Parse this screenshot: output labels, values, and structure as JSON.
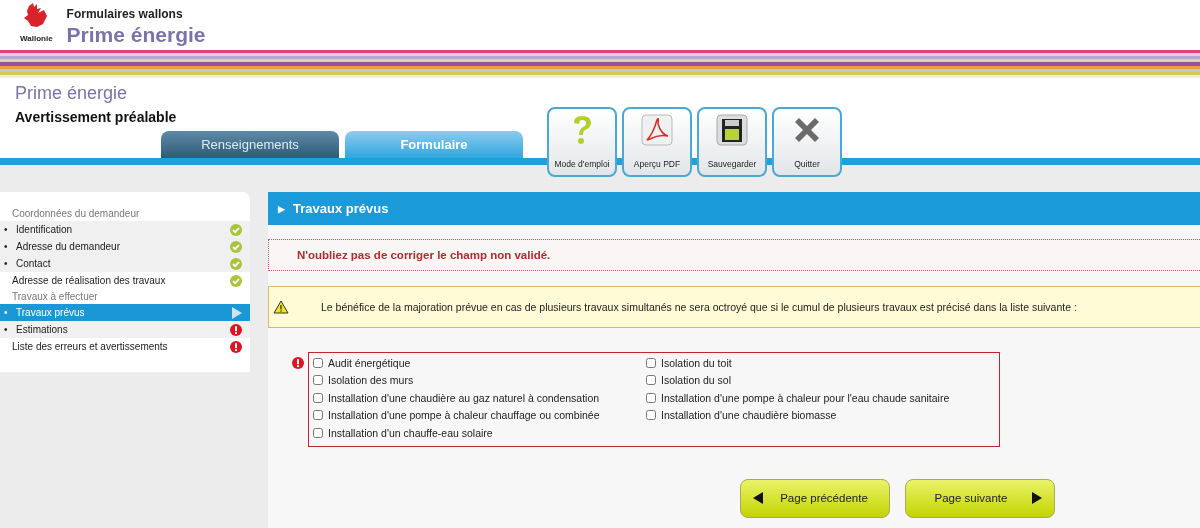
{
  "header": {
    "logo_text": "Wallonie",
    "supertitle": "Formulaires wallons",
    "title": "Prime énergie"
  },
  "form_title": "Prime énergie",
  "form_subtitle": "Avertissement préalable",
  "tabs": [
    {
      "label": "Renseignements",
      "selected": false
    },
    {
      "label": "Formulaire",
      "selected": true
    }
  ],
  "toolbar": [
    {
      "kind": "help",
      "label": "Mode d'emploi"
    },
    {
      "kind": "pdf",
      "label": "Aperçu PDF"
    },
    {
      "kind": "save",
      "label": "Sauvegarder"
    },
    {
      "kind": "quit",
      "label": "Quitter"
    }
  ],
  "sidebar": {
    "items": [
      {
        "kind": "group",
        "label": "Coordonnées du demandeur",
        "children": [
          {
            "bullet": "•",
            "label": "Identification",
            "complete": true,
            "error": false,
            "selected": false
          },
          {
            "bullet": "•",
            "label": "Adresse du demandeur",
            "complete": true,
            "error": false,
            "selected": false
          },
          {
            "bullet": "•",
            "label": "Contact",
            "complete": true,
            "error": false,
            "selected": false
          }
        ]
      },
      {
        "kind": "link",
        "label": "Adresse de réalisation des travaux",
        "complete": true,
        "error": false,
        "selected": false
      },
      {
        "kind": "group",
        "label": "Travaux à effectuer",
        "children": [
          {
            "bullet": "•",
            "label": "Travaux prévus",
            "complete": false,
            "error": false,
            "selected": true
          },
          {
            "bullet": "•",
            "label": "Estimations",
            "complete": false,
            "error": true,
            "selected": false
          }
        ]
      },
      {
        "kind": "link",
        "label": "Liste des erreurs et avertissements",
        "complete": false,
        "error": true,
        "selected": false
      }
    ]
  },
  "section": {
    "marker": "▶",
    "title": "Travaux prévus",
    "error_message": "N'oubliez pas de corriger le champ non validé.",
    "warning": "Le bénéfice de la majoration prévue en cas de plusieurs travaux simultanés ne sera octroyé que si le cumul de plusieurs travaux est précisé dans la liste suivante :",
    "checklist": {
      "invalid": true,
      "options": [
        {
          "label": "Audit énergétique",
          "checked": false
        },
        {
          "label": "Isolation du toit",
          "checked": false
        },
        {
          "label": "Isolation des murs",
          "checked": false
        },
        {
          "label": "Isolation du sol",
          "checked": false
        },
        {
          "label": "Installation d'une chaudière au gaz naturel à condensation",
          "checked": false
        },
        {
          "label": "Installation d'une pompe à chaleur pour l'eau chaude sanitaire",
          "checked": false
        },
        {
          "label": "Installation d'une pompe à chaleur chauffage ou combinée",
          "checked": false
        },
        {
          "label": "Installation d'une chaudière biomasse",
          "checked": false
        },
        {
          "label": "Installation d'un chauffe-eau solaire",
          "checked": false
        }
      ]
    }
  },
  "nav_buttons": [
    {
      "kind": "previous",
      "label": "Page précédente"
    },
    {
      "kind": "next",
      "label": "Page suivante"
    }
  ]
}
